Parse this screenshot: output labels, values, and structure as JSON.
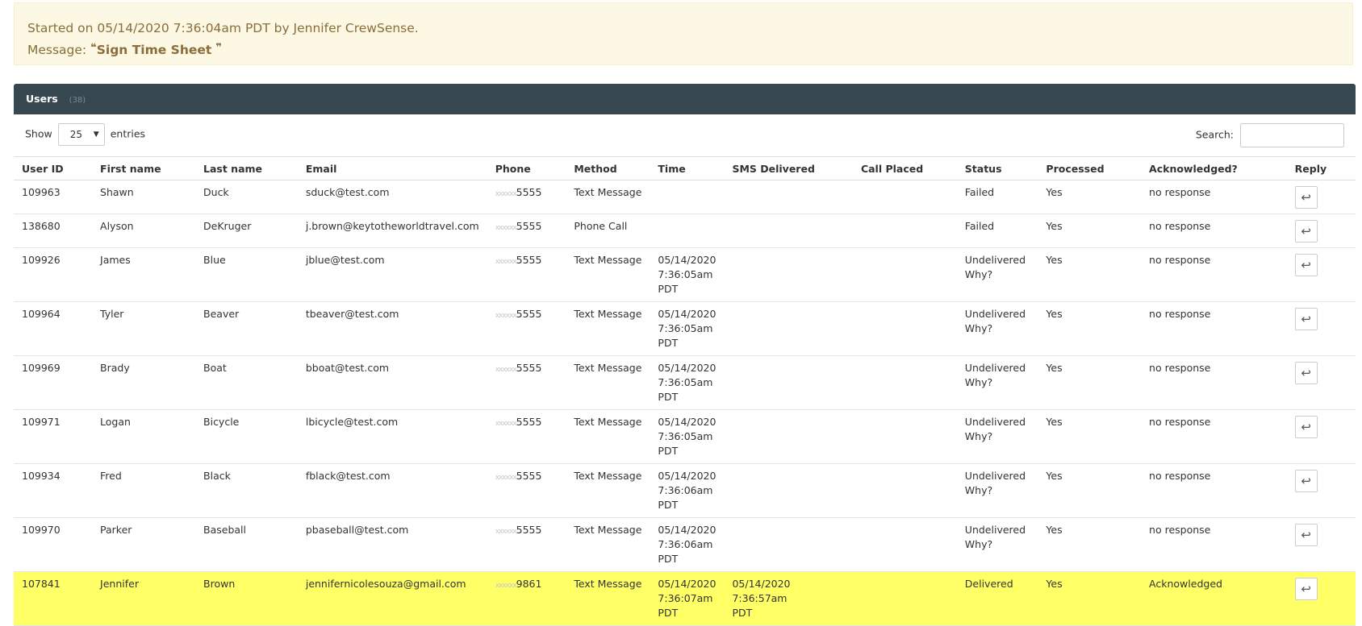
{
  "alert": {
    "started_text": "Started on 05/14/2020 7:36:04am PDT by Jennifer CrewSense.",
    "message_label": "Message:",
    "open_quote": "❝",
    "message": "Sign Time Sheet",
    "close_quote": "❞"
  },
  "panel": {
    "title": "Users",
    "count": "(38)"
  },
  "controls": {
    "show_label": "Show",
    "entries_value": "25",
    "entries_label": "entries",
    "search_label": "Search:",
    "search_value": ""
  },
  "columns": [
    "User ID",
    "First name",
    "Last name",
    "Email",
    "Phone",
    "Method",
    "Time",
    "SMS Delivered",
    "Call Placed",
    "Status",
    "Processed",
    "Acknowledged?",
    "Reply"
  ],
  "rows": [
    {
      "id": "109963",
      "first": "Shawn",
      "last": "Duck",
      "email": "sduck@test.com",
      "phone_mask": "xxxxxx",
      "phone_last": "5555",
      "method": "Text Message",
      "time": [
        "",
        "",
        ""
      ],
      "sms": [
        "",
        ""
      ],
      "call": "",
      "status": [
        "Failed",
        ""
      ],
      "processed": "Yes",
      "ack": "no response"
    },
    {
      "id": "138680",
      "first": "Alyson",
      "last": "DeKruger",
      "email": "j.brown@keytotheworldtravel.com",
      "phone_mask": "xxxxxx",
      "phone_last": "5555",
      "method": "Phone Call",
      "time": [
        "",
        "",
        ""
      ],
      "sms": [
        "",
        ""
      ],
      "call": "",
      "status": [
        "Failed",
        ""
      ],
      "processed": "Yes",
      "ack": "no response"
    },
    {
      "id": "109926",
      "first": "James",
      "last": "Blue",
      "email": "jblue@test.com",
      "phone_mask": "xxxxxx",
      "phone_last": "5555",
      "method": "Text Message",
      "time": [
        "05/14/2020",
        "7:36:05am",
        "PDT"
      ],
      "sms": [
        "",
        ""
      ],
      "call": "",
      "status": [
        "Undelivered",
        "Why?"
      ],
      "processed": "Yes",
      "ack": "no response"
    },
    {
      "id": "109964",
      "first": "Tyler",
      "last": "Beaver",
      "email": "tbeaver@test.com",
      "phone_mask": "xxxxxx",
      "phone_last": "5555",
      "method": "Text Message",
      "time": [
        "05/14/2020",
        "7:36:05am",
        "PDT"
      ],
      "sms": [
        "",
        ""
      ],
      "call": "",
      "status": [
        "Undelivered",
        "Why?"
      ],
      "processed": "Yes",
      "ack": "no response"
    },
    {
      "id": "109969",
      "first": "Brady",
      "last": "Boat",
      "email": "bboat@test.com",
      "phone_mask": "xxxxxx",
      "phone_last": "5555",
      "method": "Text Message",
      "time": [
        "05/14/2020",
        "7:36:05am",
        "PDT"
      ],
      "sms": [
        "",
        ""
      ],
      "call": "",
      "status": [
        "Undelivered",
        "Why?"
      ],
      "processed": "Yes",
      "ack": "no response"
    },
    {
      "id": "109971",
      "first": "Logan",
      "last": "Bicycle",
      "email": "lbicycle@test.com",
      "phone_mask": "xxxxxx",
      "phone_last": "5555",
      "method": "Text Message",
      "time": [
        "05/14/2020",
        "7:36:05am",
        "PDT"
      ],
      "sms": [
        "",
        ""
      ],
      "call": "",
      "status": [
        "Undelivered",
        "Why?"
      ],
      "processed": "Yes",
      "ack": "no response"
    },
    {
      "id": "109934",
      "first": "Fred",
      "last": "Black",
      "email": "fblack@test.com",
      "phone_mask": "xxxxxx",
      "phone_last": "5555",
      "method": "Text Message",
      "time": [
        "05/14/2020",
        "7:36:06am",
        "PDT"
      ],
      "sms": [
        "",
        ""
      ],
      "call": "",
      "status": [
        "Undelivered",
        "Why?"
      ],
      "processed": "Yes",
      "ack": "no response"
    },
    {
      "id": "109970",
      "first": "Parker",
      "last": "Baseball",
      "email": "pbaseball@test.com",
      "phone_mask": "xxxxxx",
      "phone_last": "5555",
      "method": "Text Message",
      "time": [
        "05/14/2020",
        "7:36:06am",
        "PDT"
      ],
      "sms": [
        "",
        ""
      ],
      "call": "",
      "status": [
        "Undelivered",
        "Why?"
      ],
      "processed": "Yes",
      "ack": "no response"
    },
    {
      "id": "107841",
      "first": "Jennifer",
      "last": "Brown",
      "email": "jennifernicolesouza@gmail.com",
      "phone_mask": "xxxxxx",
      "phone_last": "9861",
      "method": "Text Message",
      "time": [
        "05/14/2020",
        "7:36:07am",
        "PDT"
      ],
      "sms": [
        "05/14/2020 7:36:57am",
        "PDT"
      ],
      "call": "",
      "status": [
        "Delivered",
        ""
      ],
      "processed": "Yes",
      "ack": "Acknowledged"
    }
  ],
  "reply_icon_glyph": "↩",
  "colors": {
    "alert_bg": "#fcf8e3",
    "alert_text": "#8a6d3b",
    "panel_header": "#37474f",
    "highlight_row": "#ffff66"
  }
}
